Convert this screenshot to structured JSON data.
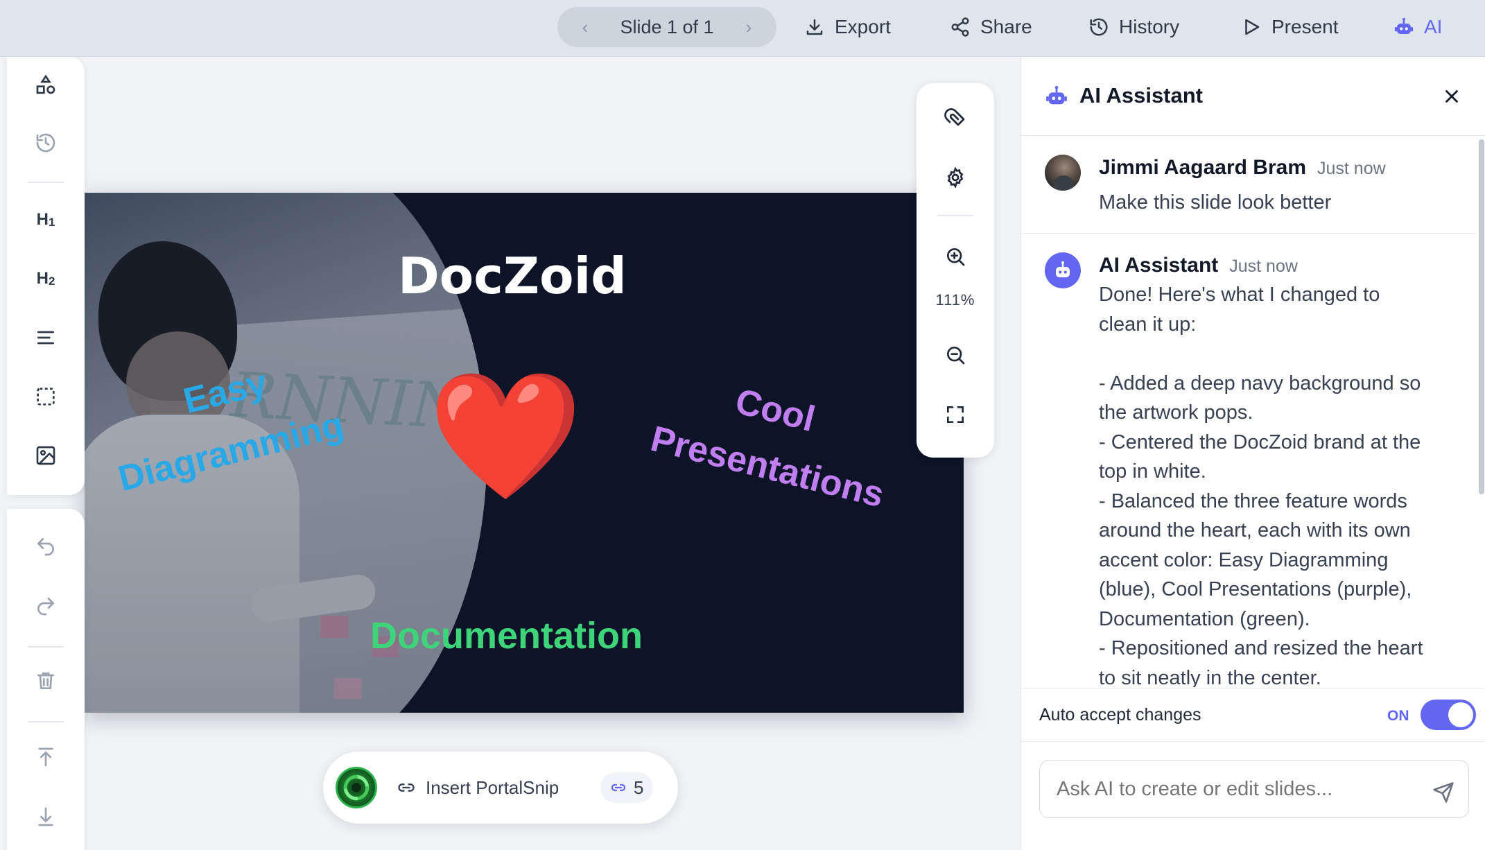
{
  "topbar": {
    "slide_nav": {
      "prev": "‹",
      "label": "Slide 1 of 1",
      "next": "›"
    },
    "export": "Export",
    "share": "Share",
    "history": "History",
    "present": "Present",
    "ai": "AI"
  },
  "toolbar": {
    "h1": "H",
    "h1_sub": "1",
    "h2": "H",
    "h2_sub": "2"
  },
  "slide": {
    "title": "DocZoid",
    "heart": "❤️",
    "word_easy": "Easy",
    "word_diagramming": "Diagramming",
    "word_cool": "Cool",
    "word_presentations": "Presentations",
    "word_documentation": "Documentation",
    "whiteboard_text": "RNNING",
    "colors": {
      "background": "#0d1427",
      "title": "#ffffff",
      "easy": "#29a8e8",
      "cool": "#c07ef0",
      "documentation": "#3ed47a"
    }
  },
  "zoom": {
    "level": "111%"
  },
  "portal": {
    "label": "Insert PortalSnip",
    "count": "5"
  },
  "ai_panel": {
    "title": "AI Assistant",
    "messages": [
      {
        "author": "Jimmi Aagaard Bram",
        "time": "Just now",
        "text": "Make this slide look better"
      },
      {
        "author": "AI Assistant",
        "time": "Just now",
        "lines": [
          "Done! Here's what I changed to",
          "clean it up:",
          "",
          "- Added a deep navy background so",
          "the artwork pops.",
          "- Centered the DocZoid brand at the",
          "top in white.",
          "- Balanced the three feature words",
          "around the heart, each with its own",
          "accent color: Easy Diagramming",
          "(blue), Cool Presentations (purple),",
          "Documentation (green).",
          "- Repositioned and resized the heart",
          "to sit neatly in the center."
        ]
      }
    ],
    "auto_accept": {
      "label": "Auto accept changes",
      "state": "ON",
      "enabled": true
    },
    "input": {
      "placeholder": "Ask AI to create or edit slides..."
    },
    "accent_color": "#6366f1"
  }
}
